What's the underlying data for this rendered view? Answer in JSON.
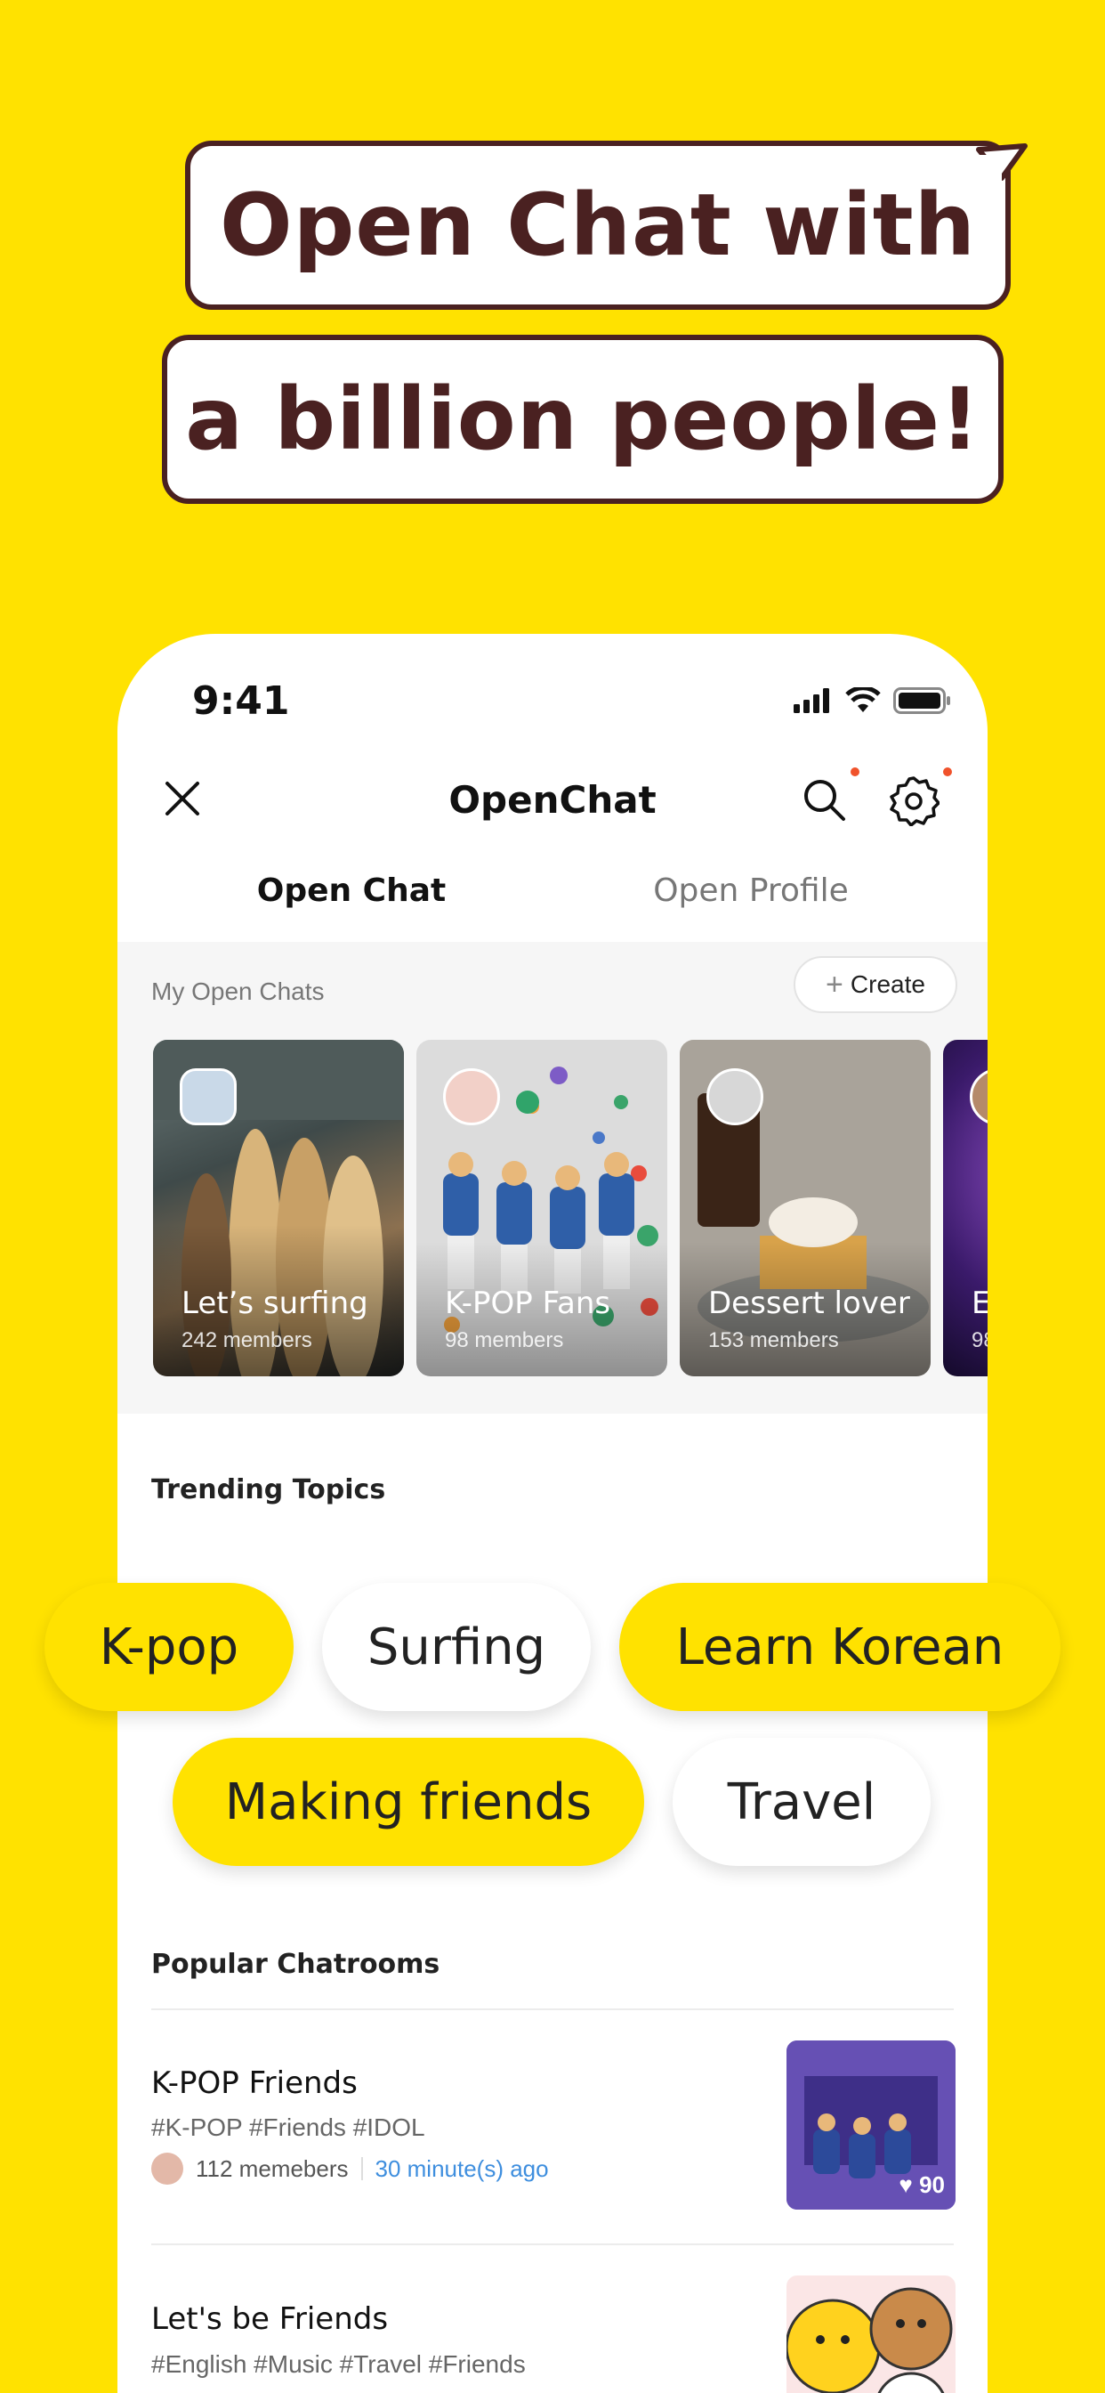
{
  "headline": {
    "line1": "Open Chat with",
    "line2": "a billion people!"
  },
  "status_bar": {
    "time": "9:41"
  },
  "nav": {
    "title": "OpenChat"
  },
  "tabs": [
    {
      "label": "Open Chat"
    },
    {
      "label": "Open Profile"
    }
  ],
  "my_open_chats": {
    "label": "My Open Chats",
    "create_label": "Create",
    "cards": [
      {
        "title": "Let’s surfing",
        "members": "242 members"
      },
      {
        "title": "K-POP Fans",
        "members": "98 members"
      },
      {
        "title": "Dessert lover",
        "members": "153 members"
      },
      {
        "title": "E",
        "members": "98"
      }
    ]
  },
  "trending": {
    "title": "Trending Topics",
    "topics": [
      {
        "label": "K-pop",
        "style": "yellow"
      },
      {
        "label": "Surfing",
        "style": "white"
      },
      {
        "label": "Learn Korean",
        "style": "yellow"
      },
      {
        "label": "Making friends",
        "style": "yellow"
      },
      {
        "label": "Travel",
        "style": "white"
      }
    ]
  },
  "popular": {
    "title": "Popular Chatrooms",
    "rooms": [
      {
        "title": "K-POP Friends",
        "tags": "#K-POP #Friends #IDOL",
        "members": "112 memebers",
        "time": "30 minute(s) ago",
        "likes": "90"
      },
      {
        "title": "Let's be Friends",
        "tags": "#English #Music #Travel #Friends"
      }
    ]
  },
  "colors": {
    "brand_yellow": "#FFE200",
    "dark_brown": "#4A2121",
    "link_blue": "#3E8EDE",
    "notification_dot": "#F0522B"
  }
}
